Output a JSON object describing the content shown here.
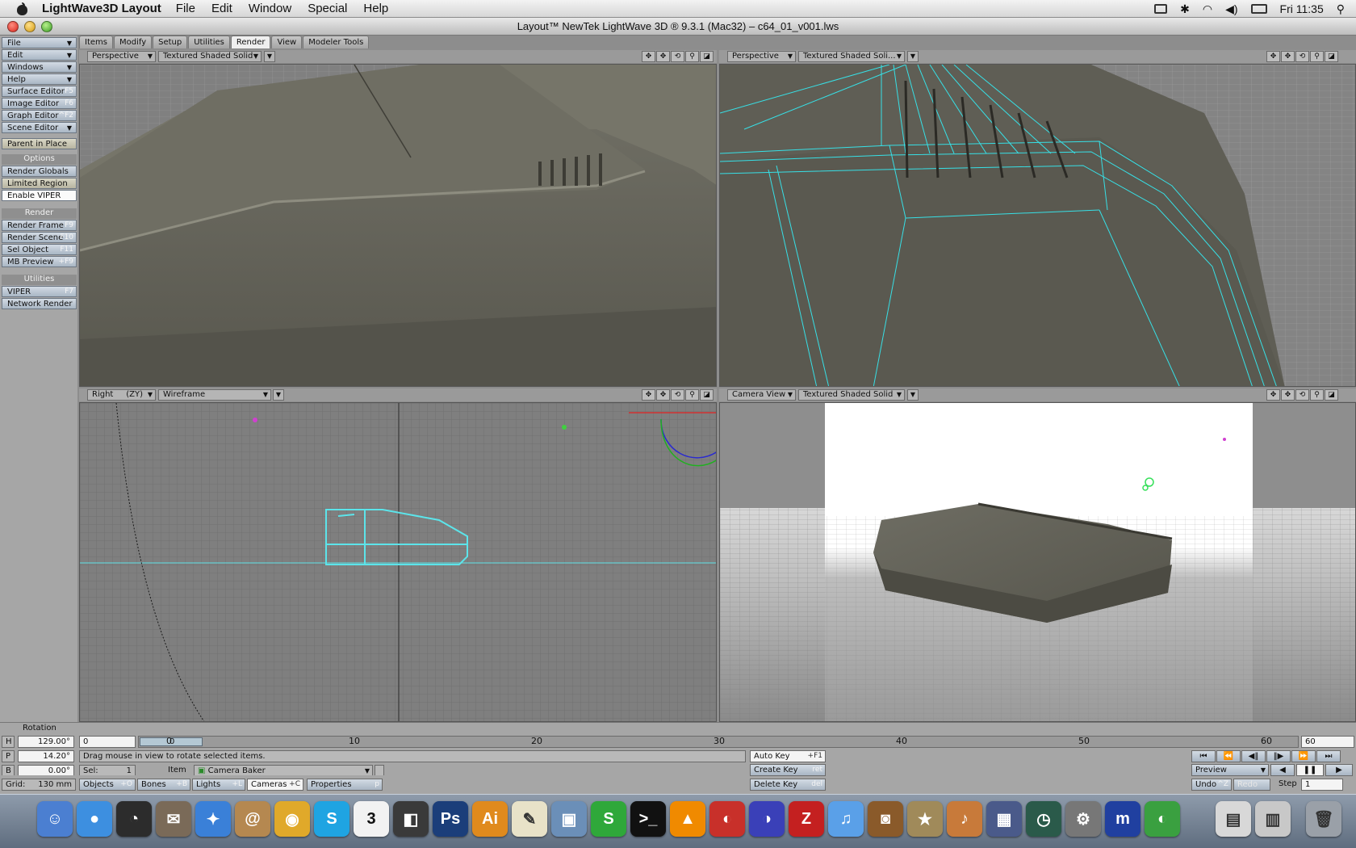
{
  "menubar": {
    "app_name": "LightWave3D Layout",
    "menus": [
      "File",
      "Edit",
      "Window",
      "Special",
      "Help"
    ],
    "clock": "Fri 11:35"
  },
  "window": {
    "title": "Layout™ NewTek LightWave 3D ® 9.3.1 (Mac32) – c64_01_v001.lws"
  },
  "left_panel": {
    "menus": [
      "File",
      "Edit",
      "Windows",
      "Help"
    ],
    "editors": [
      {
        "label": "Surface Editor",
        "hotkey": "F5"
      },
      {
        "label": "Image Editor",
        "hotkey": "F6"
      },
      {
        "label": "Graph Editor",
        "hotkey": "^F2"
      },
      {
        "label": "Scene Editor",
        "hotkey": ""
      }
    ],
    "parent_in_place": "Parent in Place",
    "options_header": "Options",
    "options": [
      "Render Globals",
      "Limited Region",
      "Enable VIPER"
    ],
    "render_header": "Render",
    "render_items": [
      {
        "label": "Render Frame",
        "hotkey": "F9"
      },
      {
        "label": "Render Scene",
        "hotkey": "F10"
      },
      {
        "label": "Sel Object",
        "hotkey": "F11"
      },
      {
        "label": "MB Preview",
        "hotkey": "+F9"
      }
    ],
    "utilities_header": "Utilities",
    "utilities": [
      {
        "label": "VIPER",
        "hotkey": "F7"
      },
      {
        "label": "Network Render",
        "hotkey": ""
      }
    ]
  },
  "tabs": [
    "Items",
    "Modify",
    "Setup",
    "Utilities",
    "Render",
    "View",
    "Modeler Tools"
  ],
  "active_tab": "Render",
  "viewports": {
    "tl": {
      "view": "Perspective",
      "mode": "Textured Shaded Solid"
    },
    "tr": {
      "view": "Perspective",
      "mode": "Textured Shaded Soli..."
    },
    "bl": {
      "view": "Right",
      "axis": "(ZY)",
      "mode": "Wireframe"
    },
    "br": {
      "view": "Camera View",
      "mode": "Textured Shaded Solid"
    }
  },
  "bottom": {
    "rotation_label": "Rotation",
    "h_label": "H",
    "h_value": "129.00°",
    "p_label": "P",
    "p_value": "14.20°",
    "b_label": "B",
    "b_value": "0.00°",
    "grid_label": "Grid:",
    "grid_value": "130 mm",
    "frame_start": "0",
    "current_frame": "0",
    "frame_end": "60",
    "ticks": [
      "0",
      "10",
      "20",
      "30",
      "40",
      "50",
      "60"
    ],
    "status": "Drag mouse in view to rotate selected items.",
    "sel_label": "Sel:",
    "sel_value": "1",
    "item_label": "Item",
    "item_value": "Camera Baker",
    "types": [
      {
        "label": "Objects",
        "hotkey": "+O"
      },
      {
        "label": "Bones",
        "hotkey": "+B"
      },
      {
        "label": "Lights",
        "hotkey": "+L"
      },
      {
        "label": "Cameras",
        "hotkey": "+C"
      }
    ],
    "properties": {
      "label": "Properties",
      "hotkey": "p"
    },
    "auto_key": {
      "label": "Auto Key",
      "hotkey": "+F1"
    },
    "create_key": {
      "label": "Create Key",
      "hotkey": "ret"
    },
    "delete_key": {
      "label": "Delete Key",
      "hotkey": "del"
    },
    "preview": "Preview",
    "undo": {
      "label": "Undo",
      "hotkey": "^Z"
    },
    "redo": "Redo",
    "step_label": "Step",
    "step_value": "1"
  },
  "dock": [
    "Finder",
    "iChat",
    "Dashboard",
    "Mail",
    "Safari",
    "Address Book",
    "Adium",
    "Skype",
    "iCal",
    "Preview",
    "Photoshop",
    "Illustrator",
    "TextEdit",
    "iPhoto",
    "S",
    "Terminal",
    "VLC",
    "LightWave",
    "LightWave Modeler",
    "FileZilla",
    "iTunes",
    "Photo Booth",
    "iMovie",
    "GarageBand",
    "Spaces",
    "Time Machine",
    "System Preferences",
    "m",
    "Hub",
    "Documents",
    "Downloads",
    "Trash"
  ]
}
